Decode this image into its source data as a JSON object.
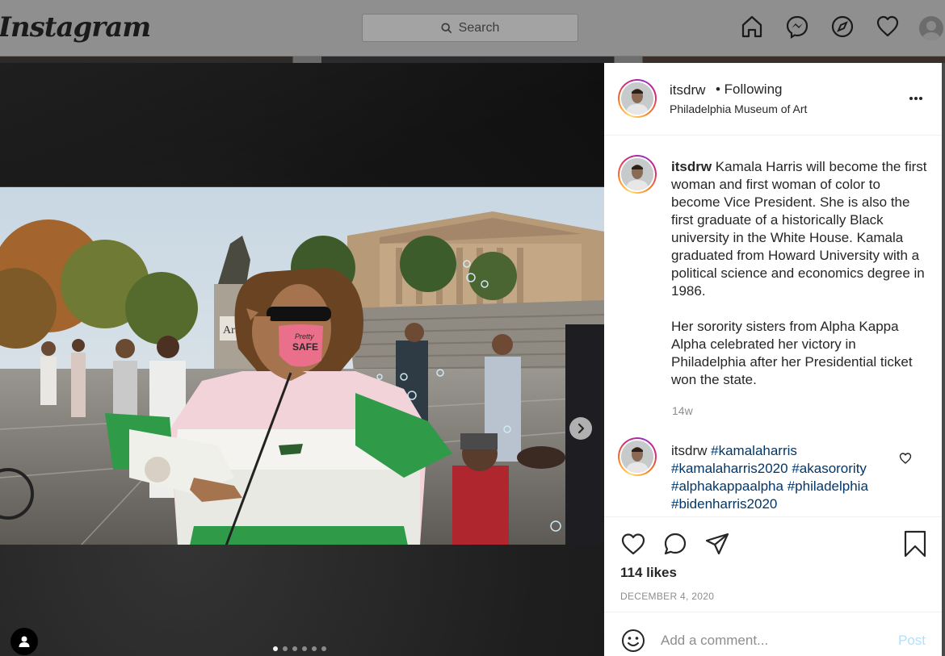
{
  "header": {
    "logo": "Instagram",
    "search_placeholder": "Search",
    "icons": [
      "home-icon",
      "messenger-icon",
      "explore-icon",
      "activity-heart-icon",
      "profile-avatar"
    ]
  },
  "post": {
    "username": "itsdrw",
    "follow_status": "• Following",
    "location": "Philadelphia Museum of Art",
    "caption_user": "itsdrw",
    "caption_p1": "Kamala Harris will become the first woman and first woman of color to become Vice President. She is also the first graduate of a historically Black university in the White House. Kamala graduated from Howard University with a political science and economics degree in 1986.",
    "caption_p2": "Her sorority sisters from Alpha Kappa Alpha celebrated her victory in Philadelphia after her Presidential ticket won the state.",
    "caption_time": "14w",
    "comment": {
      "user": "itsdrw",
      "tags": [
        "#kamalaharris",
        "#kamalaharris2020",
        "#akasorority",
        "#alphakappaalpha",
        "#philadelphia",
        "#bidenharris2020"
      ]
    },
    "likes": "114 likes",
    "date": "DECEMBER 4, 2020",
    "add_comment_placeholder": "Add a comment...",
    "post_button": "Post",
    "mask_text_1": "Pretty",
    "mask_text_2": "SAFE",
    "sign_text": "Art"
  },
  "carousel": {
    "total": 6,
    "active_index": 0
  },
  "colors": {
    "link": "#00376b",
    "post_button_disabled": "#b2dffc",
    "secondary_text": "#8e8e8e"
  }
}
